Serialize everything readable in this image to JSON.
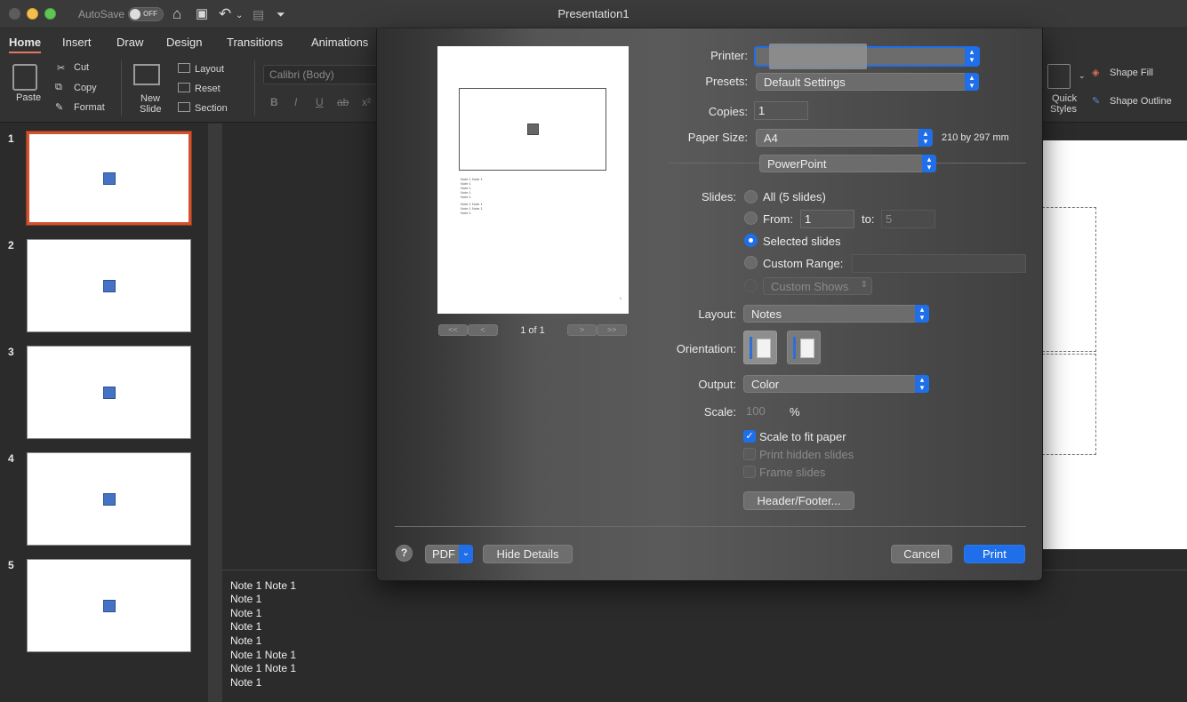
{
  "window": {
    "title": "Presentation1",
    "autosave_label": "AutoSave",
    "autosave_state": "OFF"
  },
  "ribbon": {
    "tabs": [
      "Home",
      "Insert",
      "Draw",
      "Design",
      "Transitions",
      "Animations"
    ],
    "active_tab": "Home",
    "clipboard": {
      "paste": "Paste",
      "cut": "Cut",
      "copy": "Copy",
      "format": "Format"
    },
    "slides": {
      "new_slide_line1": "New",
      "new_slide_line2": "Slide",
      "layout": "Layout",
      "reset": "Reset",
      "section": "Section"
    },
    "font": {
      "name": "Calibri (Body)",
      "bold": "B",
      "italic": "I",
      "underline": "U",
      "strike": "ab",
      "superscript": "x²"
    },
    "drawing": {
      "quick_styles_line1": "Quick",
      "quick_styles_line2": "Styles",
      "shape_fill": "Shape Fill",
      "shape_outline": "Shape Outline"
    }
  },
  "thumbnails": [
    {
      "number": "1",
      "selected": true
    },
    {
      "number": "2",
      "selected": false
    },
    {
      "number": "3",
      "selected": false
    },
    {
      "number": "4",
      "selected": false
    },
    {
      "number": "5",
      "selected": false
    }
  ],
  "notes": [
    "Note 1 Note 1",
    "Note 1",
    "Note 1",
    "Note 1",
    "Note 1",
    "Note 1 Note 1",
    "Note 1 Note 1",
    "Note 1"
  ],
  "print_dialog": {
    "preview": {
      "page_indicator": "1 of 1",
      "notes_lines": [
        "Note 1 Note 1",
        "Note 1",
        "Note 1",
        "Note 1",
        "Note 1",
        "Note 1 Note 1",
        "Note 1 Note 1",
        "Note 1"
      ],
      "page_number": "1",
      "first": "<<",
      "prev": "<",
      "next": ">",
      "last": ">>"
    },
    "printer_label": "Printer:",
    "presets_label": "Presets:",
    "presets_value": "Default Settings",
    "copies_label": "Copies:",
    "copies_value": "1",
    "paper_size_label": "Paper Size:",
    "paper_size_value": "A4",
    "paper_size_dims": "210 by 297 mm",
    "app_section": "PowerPoint",
    "slides_label": "Slides:",
    "slides_all": "All  (5 slides)",
    "slides_from": "From:",
    "slides_from_value": "1",
    "slides_to": "to:",
    "slides_to_value": "5",
    "slides_selected": "Selected slides",
    "slides_custom_range": "Custom Range:",
    "slides_custom_shows": "Custom Shows",
    "slides_choice": "Selected slides",
    "layout_label": "Layout:",
    "layout_value": "Notes",
    "orientation_label": "Orientation:",
    "output_label": "Output:",
    "output_value": "Color",
    "scale_label": "Scale:",
    "scale_value": "100",
    "scale_unit": "%",
    "scale_to_fit": "Scale to fit paper",
    "scale_to_fit_checked": true,
    "print_hidden": "Print hidden slides",
    "frame_slides": "Frame slides",
    "header_footer": "Header/Footer...",
    "help": "?",
    "pdf": "PDF",
    "hide_details": "Hide Details",
    "cancel": "Cancel",
    "print": "Print"
  },
  "colors": {
    "accent": "#1f6feb",
    "selected_thumb_border": "#d2512e",
    "slide_shape": "#4472c4"
  }
}
